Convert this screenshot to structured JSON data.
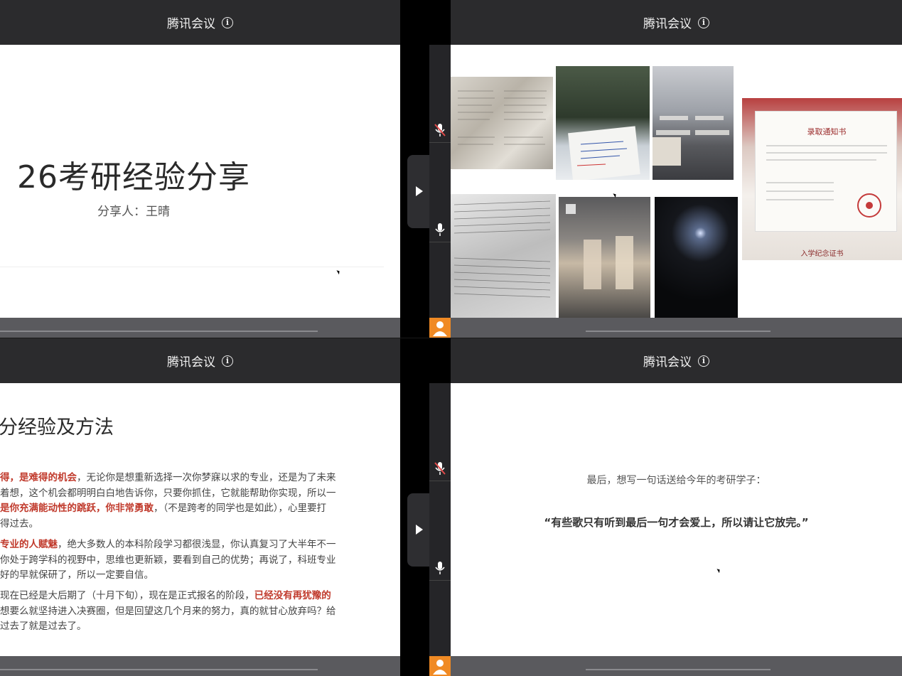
{
  "app": {
    "title": "腾讯会议",
    "info_glyph": "i"
  },
  "slide1": {
    "title": "26考研经验分享",
    "presenter": "分享人：王晴"
  },
  "slide2": {
    "photos": [
      "notes-photo",
      "desk-note-photo",
      "library-photo",
      "papers-photo",
      "hallway-photo",
      "night-road-photo",
      "admission-letter-photo"
    ],
    "letter_heading": "录取通知书",
    "certificate_text": "入学纪念证书"
  },
  "slide3": {
    "title": "分经验及方法",
    "p1_red1": "得，是难得的机会",
    "p1_text1": "，无论你是想重新选择一次你梦寐以求的专业，还是为了未来",
    "p1_line2": "着想，这个机会都明明白白地告诉你，只要你抓住，它就能帮助你实现，所以一",
    "p1_red2": "是你充满能动性的跳跃，你非常勇敢",
    "p1_text2": "，（不是跨考的同学也是如此），心里要打",
    "p1_line4": "得过去。",
    "p2_red": "专业的人赋魅",
    "p2_text1": "，绝大多数人的本科阶段学习都很浅显，你认真复习了大半年不一",
    "p2_line2": "你处于跨学科的视野中，思维也更新颖，要看到自己的优势；再说了，科班专业",
    "p2_line3": "好的早就保研了，所以一定要自信。",
    "p3_text1": "现在已经是大后期了（十月下旬），现在是正式报名的阶段，",
    "p3_red": "已经没有再犹豫的",
    "p3_line2": "想要么就坚持进入决赛圈，但是回望这几个月来的努力，真的就甘心放弃吗？给",
    "p3_line3": "过去了就是过去了。"
  },
  "slide4": {
    "lead": "最后，想写一句话送给今年的考研学子：",
    "quote": "“有些歌只有听到最后一句才会爱上，所以请让它放完。”"
  },
  "icons": {
    "mic_muted": "mic-muted-icon",
    "mic": "mic-icon",
    "avatar": "user-avatar-icon",
    "expand": "expand-arrow-icon"
  }
}
